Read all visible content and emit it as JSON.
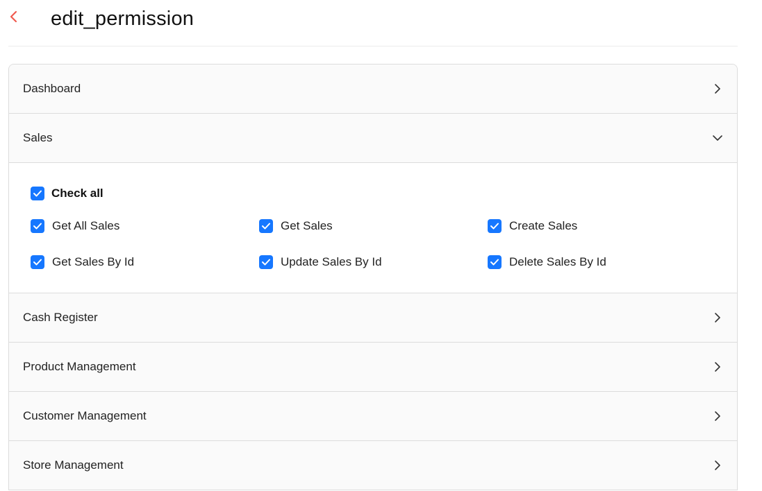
{
  "page": {
    "title": "edit_permission"
  },
  "icons": {
    "back": "chevron-left-icon",
    "collapsed": "chevron-right-icon",
    "expanded": "chevron-down-icon",
    "check": "checkmark-icon"
  },
  "colors": {
    "back_icon": "#f05a4f",
    "checkbox_fill": "#1677ff",
    "panel_bg": "#fafafa",
    "border": "#dcdcdc"
  },
  "sections": [
    {
      "label": "Dashboard",
      "expanded": false
    },
    {
      "label": "Sales",
      "expanded": true
    },
    {
      "label": "Cash Register",
      "expanded": false
    },
    {
      "label": "Product Management",
      "expanded": false
    },
    {
      "label": "Customer Management",
      "expanded": false
    },
    {
      "label": "Store Management",
      "expanded": false
    }
  ],
  "sales_permissions": {
    "check_all_label": "Check all",
    "check_all_checked": true,
    "items": [
      {
        "label": "Get All Sales",
        "checked": true
      },
      {
        "label": "Get Sales",
        "checked": true
      },
      {
        "label": "Create Sales",
        "checked": true
      },
      {
        "label": "Get Sales By Id",
        "checked": true
      },
      {
        "label": "Update Sales By Id",
        "checked": true
      },
      {
        "label": "Delete Sales By Id",
        "checked": true
      }
    ]
  }
}
